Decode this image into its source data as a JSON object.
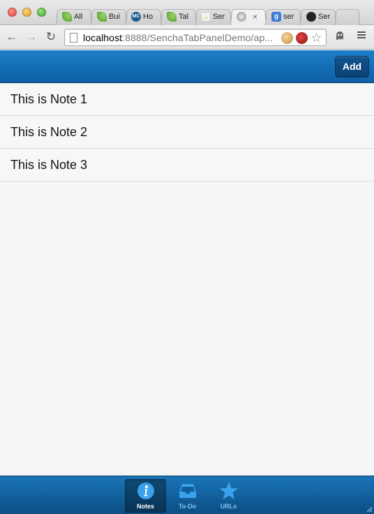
{
  "browser": {
    "tabs": [
      {
        "label": "All",
        "favicon": "leaf-icon"
      },
      {
        "label": "Bui",
        "favicon": "leaf-icon"
      },
      {
        "label": "Ho",
        "favicon": "mc-icon"
      },
      {
        "label": "Tal",
        "favicon": "leaf-icon"
      },
      {
        "label": "Ser",
        "favicon": "arrow-icon"
      },
      {
        "label": "",
        "favicon": "globe-icon"
      },
      {
        "label": "ser",
        "favicon": "google-icon"
      },
      {
        "label": "Ser",
        "favicon": "github-icon"
      }
    ],
    "url_host": "localhost",
    "url_rest": ":8888/SenchaTabPanelDemo/ap...",
    "tab_close_glyph": "×",
    "mc_favicon_text": "MC",
    "google_favicon_text": "g"
  },
  "app": {
    "header": {
      "add_label": "Add"
    },
    "notes": [
      "This is Note 1",
      "This is Note 2",
      "This is Note 3"
    ],
    "tabbar": {
      "items": [
        {
          "label": "Notes",
          "icon": "info-icon",
          "active": true
        },
        {
          "label": "To-Do",
          "icon": "inbox-icon",
          "active": false
        },
        {
          "label": "URLs",
          "icon": "star-icon",
          "active": false
        }
      ]
    }
  },
  "colors": {
    "header_blue": "#1876c0",
    "tab_active_label": "#ffffff",
    "tab_inactive_label": "#7fc3f3"
  }
}
